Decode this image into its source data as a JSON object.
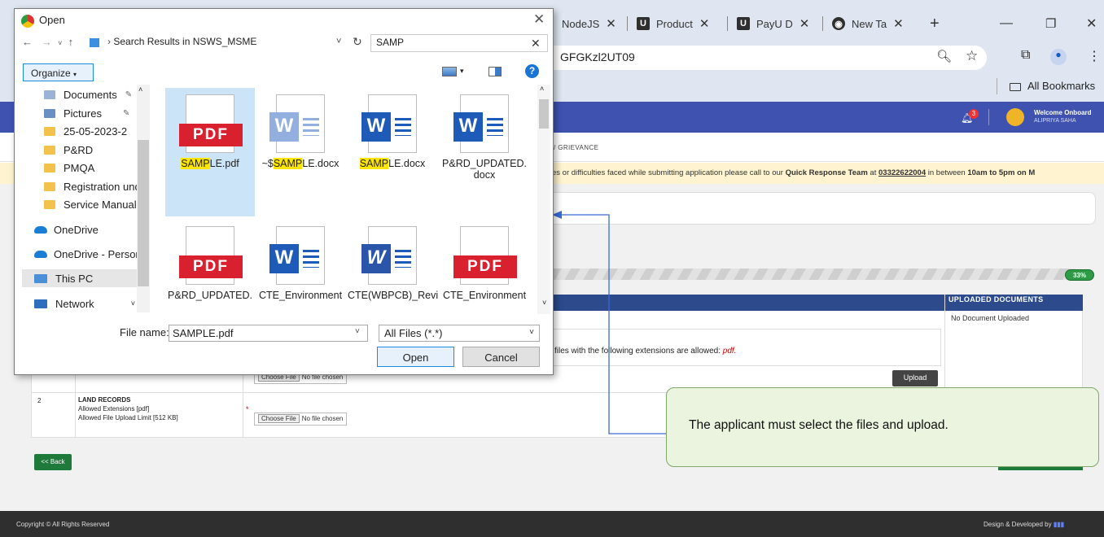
{
  "browser": {
    "tabs": [
      {
        "label": "NodeJS"
      },
      {
        "label": "Product"
      },
      {
        "label": "PayU D"
      },
      {
        "label": "New Ta"
      }
    ],
    "address_fragment": "GFGKzl2UT09",
    "bookmarks_label": "All Bookmarks",
    "new_tab_symbol": "+"
  },
  "portal": {
    "welcome": "Welcome Onboard",
    "user": "ALIPRIYA SAHA",
    "notification_count": "3",
    "breadcrumb": "/ GRIEVANCE",
    "notice": {
      "text_before": "es or difficulties faced while submitting application please call to our",
      "team": "Quick Response Team",
      "at": "at",
      "phone": "03322622004",
      "between": "in between",
      "hours": "10am to 5pm on M"
    },
    "progress_pct": "33%",
    "progress_value": 0.33,
    "uploaded_header": "UPLOADED DOCUMENTS",
    "no_doc": "No Document Uploaded",
    "allowed_text": "files with the following extensions are allowed:",
    "allowed_ext": "pdf.",
    "upload_btn": "Upload",
    "choose_file": "Choose File",
    "no_file": "No file chosen",
    "row2": {
      "num": "2",
      "title": "LAND RECORDS",
      "ext": "Allowed Extensions [pdf]",
      "limit": "Allowed File Upload Limit [512 KB]"
    },
    "back_btn": "<< Back",
    "footer_left": "Copyright © All Rights Reserved",
    "footer_right": "Design & Developed by"
  },
  "callout": "The applicant must select the files and upload.",
  "dialog": {
    "title": "Open",
    "path": "Search Results in NSWS_MSME",
    "search": "SAMP",
    "organize": "Organize",
    "sidebar": [
      {
        "label": "Documents",
        "icon": "documents-icon"
      },
      {
        "label": "Pictures",
        "icon": "pictures-icon"
      },
      {
        "label": "25-05-2023-2",
        "icon": "folder-icon"
      },
      {
        "label": "P&RD",
        "icon": "folder-icon"
      },
      {
        "label": "PMQA",
        "icon": "folder-icon"
      },
      {
        "label": "Registration und",
        "icon": "folder-icon"
      },
      {
        "label": "Service Manuals",
        "icon": "folder-icon"
      },
      {
        "label": "OneDrive",
        "icon": "cloud-icon"
      },
      {
        "label": "OneDrive - Person",
        "icon": "cloud-icon"
      },
      {
        "label": "This PC",
        "icon": "pc-icon"
      },
      {
        "label": "Network",
        "icon": "network-icon"
      }
    ],
    "files": [
      {
        "hl": "SAMP",
        "rest": "LE.pdf",
        "pre": "",
        "type": "pdf"
      },
      {
        "pre": "~$",
        "hl": "SAMP",
        "rest": "LE.docx",
        "type": "word-light"
      },
      {
        "pre": "",
        "hl": "SAMP",
        "rest": "LE.docx",
        "type": "word"
      },
      {
        "pre": "P&RD_UPDATED.",
        "hl": "",
        "rest": "docx",
        "type": "word"
      },
      {
        "pre": "P&RD_UPDATED.",
        "hl": "",
        "rest": "",
        "type": "pdf"
      },
      {
        "pre": "CTE_Environment",
        "hl": "",
        "rest": "",
        "type": "word"
      },
      {
        "pre": "CTE(WBPCB)_Revi",
        "hl": "",
        "rest": "",
        "type": "word-old"
      },
      {
        "pre": "CTE_Environment",
        "hl": "",
        "rest": "",
        "type": "pdf"
      }
    ],
    "pdf_label": "PDF",
    "word_label": "W",
    "filename_label": "File name:",
    "filename_value": "SAMPLE.pdf",
    "filetype": "All Files (*.*)",
    "open_btn": "Open",
    "cancel_btn": "Cancel"
  }
}
